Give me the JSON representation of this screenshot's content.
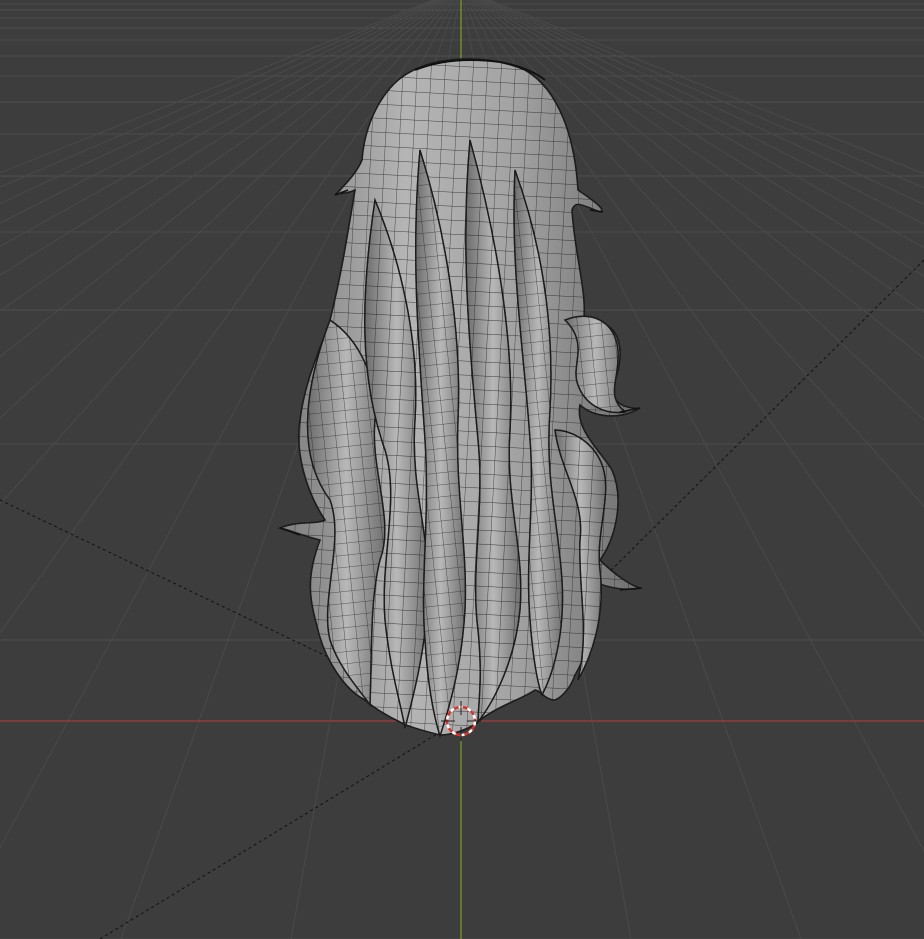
{
  "viewport": {
    "background": "#3d3d3d",
    "grid_color": "#4a4a4a",
    "grid_major_color": "#505050",
    "x_axis_color": "#c0393b",
    "y_axis_color": "#8ab11e",
    "guide_color": "#111111",
    "mesh_fill": "#9e9e9e",
    "mesh_wire": "#1a1a1a",
    "cursor_color_a": "#ffffff",
    "cursor_color_b": "#d8342c"
  },
  "scene": {
    "object": "hair-mesh",
    "view": "perspective",
    "shading": "solid-wireframe-overlay"
  },
  "icons": {
    "cursor": "3d-cursor-icon"
  }
}
